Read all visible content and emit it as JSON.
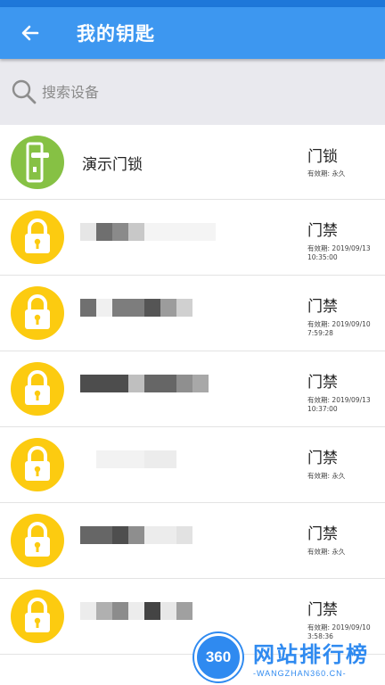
{
  "header": {
    "title": "我的钥匙",
    "back_icon": "arrow-left-icon"
  },
  "search": {
    "placeholder": "搜索设备",
    "icon": "search-icon"
  },
  "colors": {
    "appbar": "#3d97f0",
    "lock_green": "#86c144",
    "access_yellow": "#fccb10"
  },
  "keys": [
    {
      "name": "演示门锁",
      "type": "门锁",
      "validity_label": "有效期:",
      "validity": "永久",
      "icon": "door-lock-icon",
      "color": "green",
      "blurred": false
    },
    {
      "name": "",
      "type": "门禁",
      "validity_label": "有效期:",
      "validity": "2019/09/13 10:35:00",
      "icon": "padlock-icon",
      "color": "yellow",
      "blurred": true
    },
    {
      "name": "",
      "type": "门禁",
      "validity_label": "有效期:",
      "validity": "2019/09/10 7:59:28",
      "icon": "padlock-icon",
      "color": "yellow",
      "blurred": true
    },
    {
      "name": "",
      "type": "门禁",
      "validity_label": "有效期:",
      "validity": "2019/09/13 10:37:00",
      "icon": "padlock-icon",
      "color": "yellow",
      "blurred": true
    },
    {
      "name": "",
      "type": "门禁",
      "validity_label": "有效期:",
      "validity": "永久",
      "icon": "padlock-icon",
      "color": "yellow",
      "blurred": true
    },
    {
      "name": "",
      "type": "门禁",
      "validity_label": "有效期:",
      "validity": "永久",
      "icon": "padlock-icon",
      "color": "yellow",
      "blurred": true
    },
    {
      "name": "",
      "type": "门禁",
      "validity_label": "有效期:",
      "validity": "2019/09/10 3:58:36",
      "icon": "padlock-icon",
      "color": "yellow",
      "blurred": true
    }
  ],
  "watermark": {
    "logo_text": "360",
    "title": "网站排行榜",
    "subtitle": "-WANGZHAN360.CN-"
  }
}
